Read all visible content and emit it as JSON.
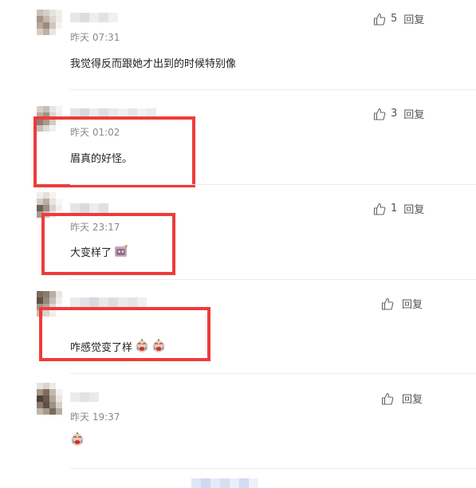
{
  "comments": [
    {
      "time": "昨天 07:31",
      "text": "我觉得反而跟她才出到的时候特别像",
      "likes": "5",
      "reply": "回复",
      "emojis": []
    },
    {
      "time": "昨天 01:02",
      "text": "眉真的好怪。",
      "likes": "3",
      "reply": "回复",
      "emojis": []
    },
    {
      "time": "昨天 23:17",
      "text": "大变样了",
      "likes": "1",
      "reply": "回复",
      "emojis": [
        "sticker-icon"
      ]
    },
    {
      "time": "",
      "text": "咋感觉变了样",
      "likes": "",
      "reply": "回复",
      "emojis": [
        "crying-face-icon",
        "crying-face-icon"
      ]
    },
    {
      "time": "昨天 19:37",
      "text": "",
      "likes": "",
      "reply": "回复",
      "emojis": [
        "crying-face-icon"
      ]
    }
  ],
  "colors": {
    "highlight": "#ef3b3b",
    "time_text": "#8a8a8a",
    "divider": "#ececec"
  }
}
